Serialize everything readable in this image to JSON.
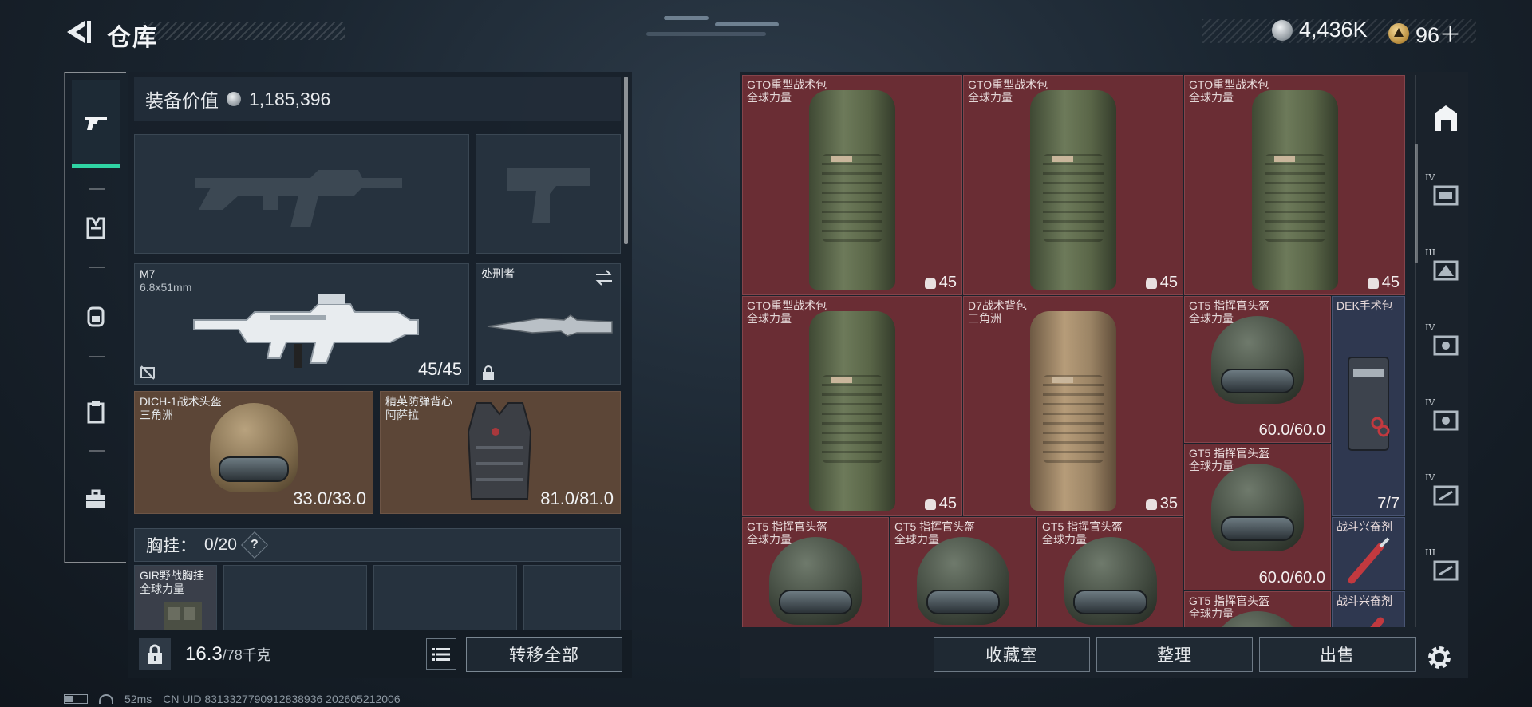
{
  "header": {
    "title": "仓库",
    "currency": [
      {
        "icon": "silver-coin-icon",
        "value": "4,436K"
      },
      {
        "icon": "gold-coin-icon",
        "value": "96＋"
      }
    ]
  },
  "leftnav": {
    "items": [
      {
        "icon": "pistol-icon",
        "active": true
      },
      {
        "icon": "armor-icon",
        "active": false
      },
      {
        "icon": "backpack-icon",
        "active": false
      },
      {
        "icon": "clipboard-icon",
        "active": false
      },
      {
        "icon": "briefcase-icon",
        "active": false
      }
    ]
  },
  "loadout": {
    "value_label": "装备价值",
    "value": "1,185,396",
    "primary_weapon": {
      "name": "M7",
      "caliber": "6.8x51mm",
      "ammo": "45/45"
    },
    "melee": {
      "name": "处刑者"
    },
    "helmet": {
      "name": "DICH-1战术头盔",
      "origin": "三角洲",
      "durability": "33.0/33.0"
    },
    "armor": {
      "name": "精英防弹背心",
      "origin": "阿萨拉",
      "durability": "81.0/81.0"
    },
    "chest_rig": {
      "label": "胸挂：",
      "capacity": "0/20",
      "help": "?"
    },
    "rig_slot": {
      "name": "GIR野战胸挂",
      "origin": "全球力量"
    },
    "footer": {
      "weight": "16.3",
      "weight_max": "/78千克",
      "transfer_all": "转移全部"
    }
  },
  "stash": {
    "items": [
      {
        "name": "GTO重型战术包",
        "origin": "全球力量",
        "value": "45",
        "kind": "backpack"
      },
      {
        "name": "GTO重型战术包",
        "origin": "全球力量",
        "value": "45",
        "kind": "backpack"
      },
      {
        "name": "GTO重型战术包",
        "origin": "全球力量",
        "value": "45",
        "kind": "backpack"
      },
      {
        "name": "GTO重型战术包",
        "origin": "全球力量",
        "value": "45",
        "kind": "backpack"
      },
      {
        "name": "D7战术背包",
        "origin": "三角洲",
        "value": "35",
        "kind": "backpack-tan"
      },
      {
        "name": "GT5 指挥官头盔",
        "origin": "全球力量",
        "value": "60.0/60.0",
        "kind": "helmet"
      },
      {
        "name": "DEK手术包",
        "origin": "",
        "value": "7/7",
        "kind": "medkit"
      },
      {
        "name": "GT5 指挥官头盔",
        "origin": "全球力量",
        "value": "60.0/60.0",
        "kind": "helmet"
      },
      {
        "name": "GT5 指挥官头盔",
        "origin": "全球力量",
        "value": "",
        "kind": "helmet"
      },
      {
        "name": "GT5 指挥官头盔",
        "origin": "全球力量",
        "value": "",
        "kind": "helmet"
      },
      {
        "name": "GT5 指挥官头盔",
        "origin": "全球力量",
        "value": "",
        "kind": "helmet"
      },
      {
        "name": "战斗兴奋剂",
        "origin": "",
        "value": "",
        "kind": "stim"
      },
      {
        "name": "GT5 指挥官头盔",
        "origin": "全球力量",
        "value": "",
        "kind": "helmet"
      },
      {
        "name": "战斗兴奋剂",
        "origin": "",
        "value": "",
        "kind": "stim"
      }
    ],
    "rail": [
      {
        "icon": "stash-home-icon",
        "label": ""
      },
      {
        "icon": "container-iv-icon",
        "label": "IV"
      },
      {
        "icon": "container-iii-icon",
        "label": "III"
      },
      {
        "icon": "container-iv-b-icon",
        "label": "IV"
      },
      {
        "icon": "container-iv-c-icon",
        "label": "IV"
      },
      {
        "icon": "container-iv-d-icon",
        "label": "IV"
      },
      {
        "icon": "container-iii-b-icon",
        "label": "III"
      }
    ],
    "footer": {
      "collection": "收藏室",
      "organize": "整理",
      "sell": "出售"
    }
  },
  "status": {
    "ping": "52ms",
    "uid": "CN UID 8313327790912838936 202605212006"
  }
}
